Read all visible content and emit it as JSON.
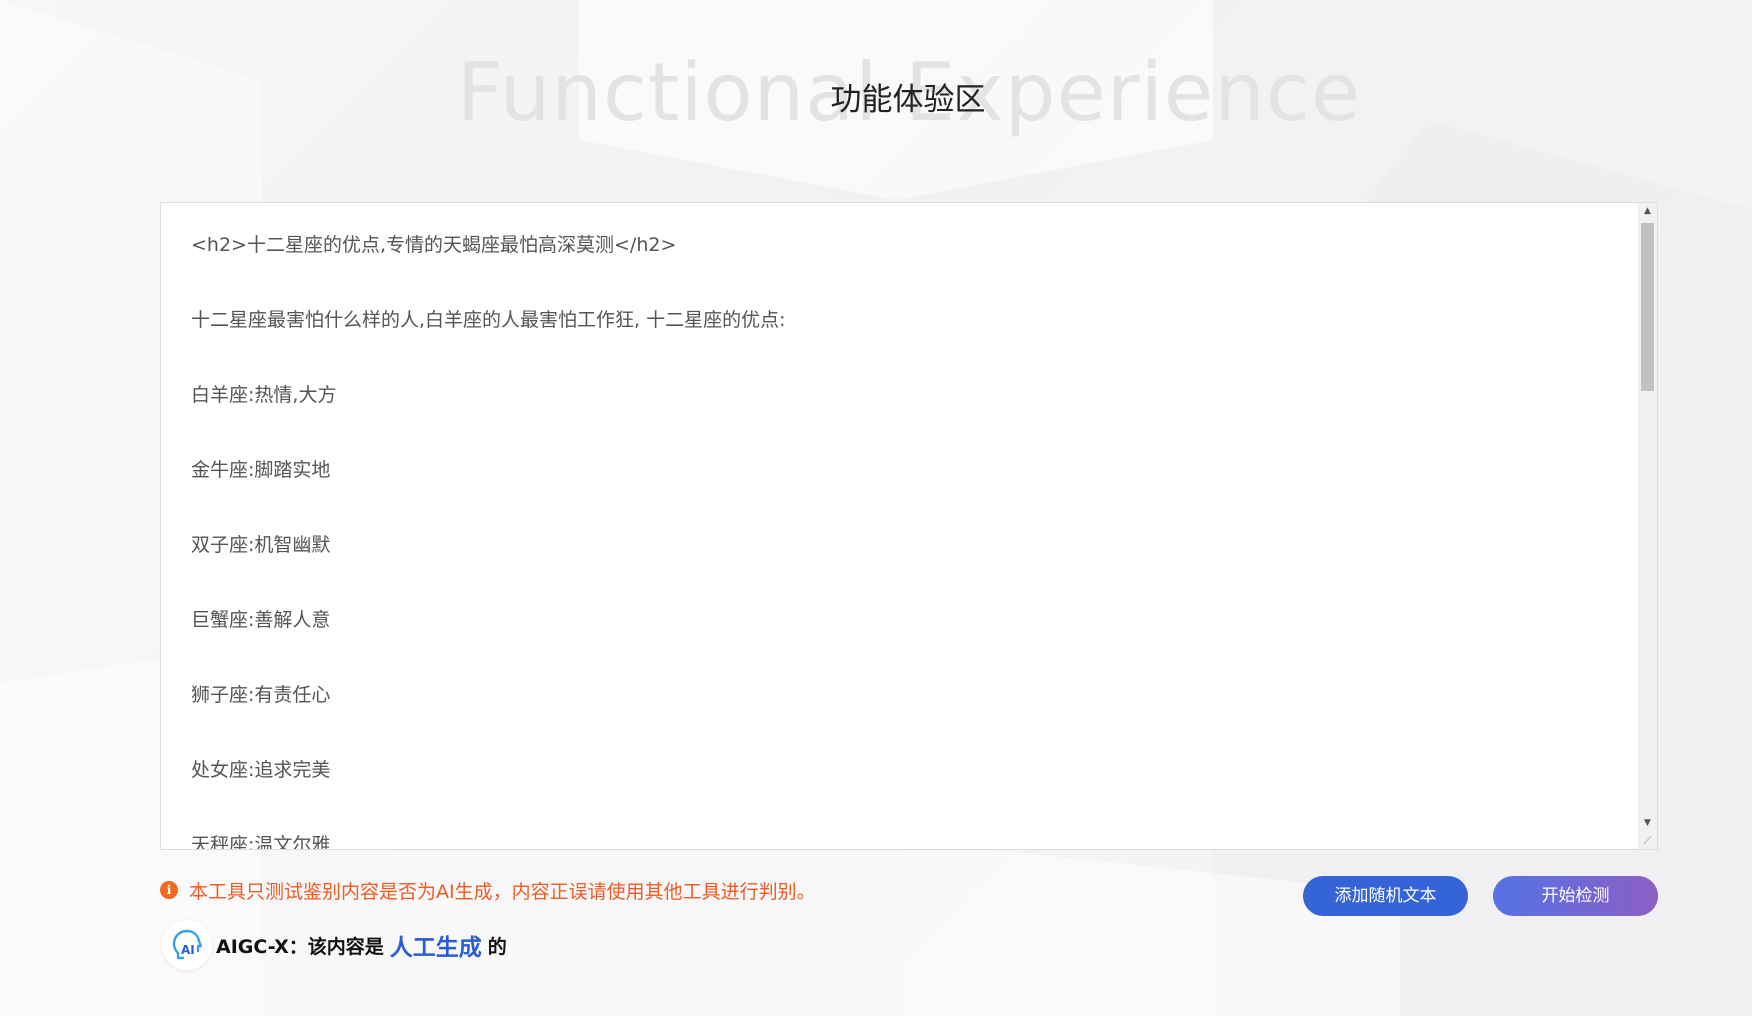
{
  "header": {
    "watermark": "Functional Experience",
    "title": "功能体验区"
  },
  "editor": {
    "lines": [
      "<h2>十二星座的优点,专情的天蝎座最怕高深莫测</h2>",
      "十二星座最害怕什么样的人,白羊座的人最害怕工作狂, 十二星座的优点:",
      "白羊座:热情,大方",
      "金牛座:脚踏实地",
      "双子座:机智幽默",
      "巨蟹座:善解人意",
      "狮子座:有责任心",
      "处女座:追求完美",
      "天秤座:温文尔雅"
    ]
  },
  "notice": {
    "icon": "info-icon",
    "text": "本工具只测试鉴别内容是否为AI生成，内容正误请使用其他工具进行判别。",
    "color": "#f15a24"
  },
  "result": {
    "prefix": "AIGC-X：该内容是",
    "value": "人工生成",
    "suffix": "的",
    "value_color": "#2a5bd7"
  },
  "buttons": {
    "add_random_text": "添加随机文本",
    "start_detection": "开始检测"
  }
}
